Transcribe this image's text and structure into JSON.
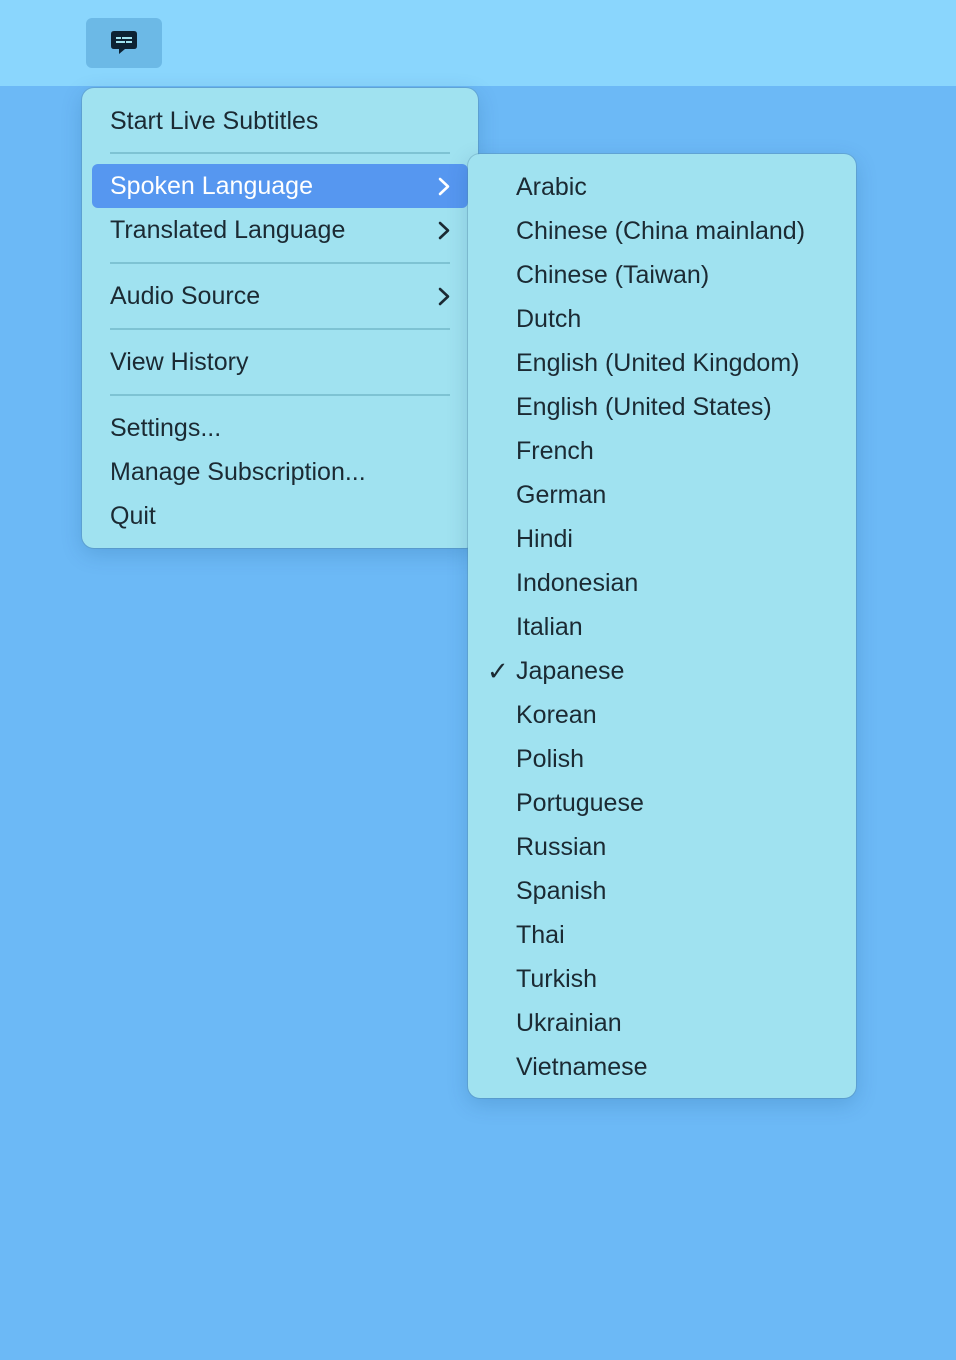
{
  "menubar": {
    "status_icon": "captions-bubble-icon"
  },
  "menu": {
    "start_subtitles": "Start Live Subtitles",
    "spoken_language": "Spoken Language",
    "translated_language": "Translated Language",
    "audio_source": "Audio Source",
    "view_history": "View History",
    "settings": "Settings...",
    "manage_subscription": "Manage Subscription...",
    "quit": "Quit"
  },
  "submenu": {
    "languages": [
      "Arabic",
      "Chinese (China mainland)",
      "Chinese (Taiwan)",
      "Dutch",
      "English (United Kingdom)",
      "English (United States)",
      "French",
      "German",
      "Hindi",
      "Indonesian",
      "Italian",
      "Japanese",
      "Korean",
      "Polish",
      "Portuguese",
      "Russian",
      "Spanish",
      "Thai",
      "Turkish",
      "Ukrainian",
      "Vietnamese"
    ],
    "selected": "Japanese",
    "check_glyph": "✓"
  },
  "colors": {
    "background": "#6cb9f6",
    "menubar": "#8ad6fd",
    "menu": "#a0e2f0",
    "highlight": "#5697f0"
  }
}
